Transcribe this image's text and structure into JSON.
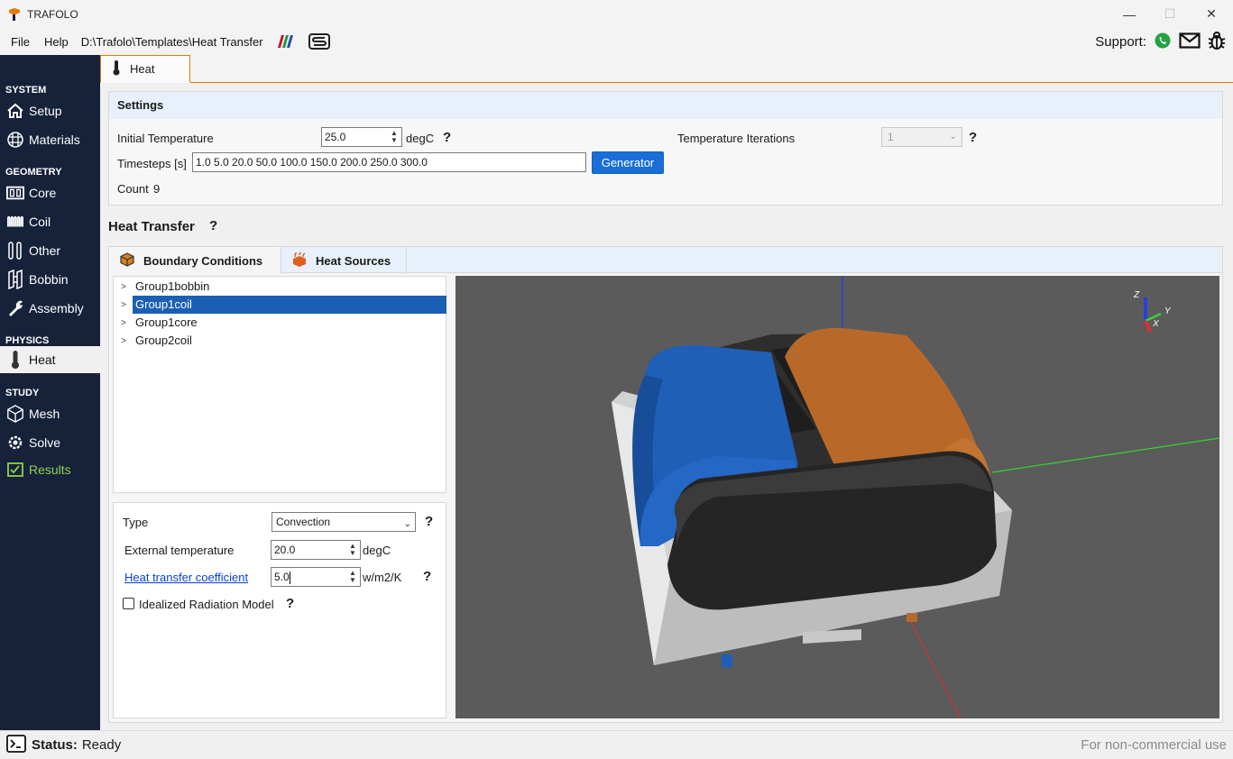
{
  "window": {
    "title": "TRAFOLO",
    "controls": {
      "minimize": "—",
      "maximize": "☐",
      "close": "✕"
    }
  },
  "menu": {
    "file": "File",
    "help": "Help",
    "path": "D:\\Trafolo\\Templates\\Heat Transfer",
    "support_label": "Support:",
    "icons": [
      "matlab-icon",
      "s-logo-icon",
      "whatsapp-icon",
      "mail-icon",
      "bug-icon"
    ]
  },
  "sidebar": {
    "sections": {
      "system": "SYSTEM",
      "geometry": "GEOMETRY",
      "physics": "PHYSICS",
      "study": "STUDY"
    },
    "items": {
      "setup": "Setup",
      "materials": "Materials",
      "core": "Core",
      "coil": "Coil",
      "other": "Other",
      "bobbin": "Bobbin",
      "assembly": "Assembly",
      "heat": "Heat",
      "mesh": "Mesh",
      "solve": "Solve",
      "results": "Results"
    },
    "active": "heat"
  },
  "tabs": {
    "main": "Heat"
  },
  "settings": {
    "header": "Settings",
    "initial_temperature_label": "Initial Temperature",
    "initial_temperature_value": "25.0",
    "initial_temperature_unit": "degC",
    "help": "?",
    "temperature_iterations_label": "Temperature Iterations",
    "temperature_iterations_value": "1",
    "timesteps_label": "Timesteps [s]",
    "timesteps_value": "1.0 5.0 20.0 50.0 100.0 150.0 200.0 250.0 300.0",
    "generator_button": "Generator",
    "count_label": "Count",
    "count_value": "9"
  },
  "heat_transfer": {
    "title": "Heat Transfer",
    "help": "?",
    "subtabs": {
      "boundary": "Boundary Conditions",
      "sources": "Heat Sources"
    },
    "tree": [
      {
        "label": "Group1bobbin"
      },
      {
        "label": "Group1coil"
      },
      {
        "label": "Group1core"
      },
      {
        "label": "Group2coil"
      }
    ],
    "selected_index": 1,
    "props": {
      "type_label": "Type",
      "type_value": "Convection",
      "ext_temp_label": "External temperature",
      "ext_temp_value": "20.0",
      "ext_temp_unit": "degC",
      "htc_label": "Heat transfer coefficient",
      "htc_value": "5.0",
      "htc_unit": "w/m2/K",
      "radiation_label": "Idealized Radiation Model",
      "radiation_checked": false,
      "help": "?"
    }
  },
  "viewport": {
    "axes": {
      "z": "Z",
      "y": "Y",
      "x": "X"
    },
    "colors": {
      "background": "#5b5b5b",
      "coil_blue": "#1f5fb8",
      "coil_orange": "#b8692a",
      "core": "#2f2f2f",
      "bobbin": "#cfcfcf"
    }
  },
  "status": {
    "label": "Status:",
    "value": "Ready",
    "license": "For non-commercial use"
  }
}
